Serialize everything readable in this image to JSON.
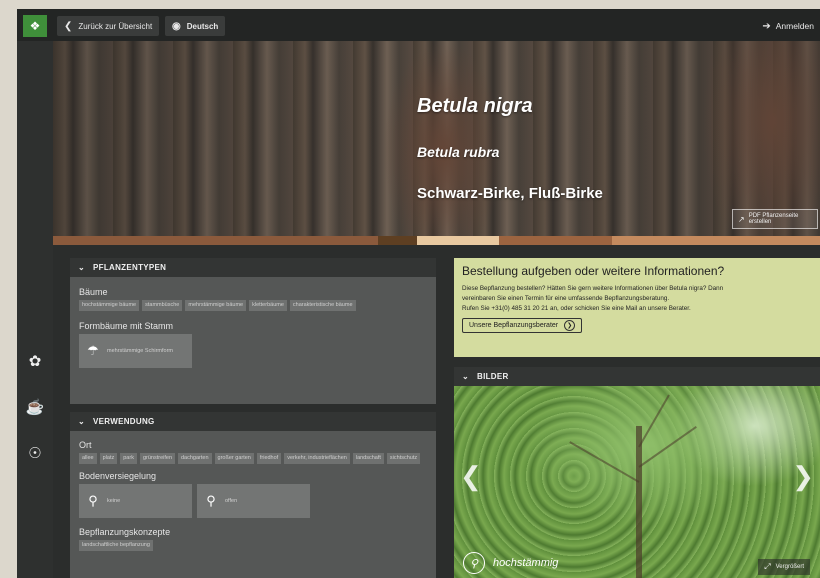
{
  "topbar": {
    "logo_icon": "plant-book-icon",
    "back_label": "Zurück zur Übersicht",
    "language_label": "Deutsch",
    "login_label": "Anmelden"
  },
  "hero": {
    "title": "Betula nigra",
    "synonym": "Betula rubra",
    "common_name": "Schwarz-Birke, Fluß-Birke",
    "pdf_button": "PDF Pflanzenseite erstellen"
  },
  "swatches": [
    "#8b5a3c",
    "#8b5a3c",
    "#5e3f22",
    "#e9c9a0",
    "#9c6440",
    "#c48a5e"
  ],
  "pflanzentypen": {
    "header": "PFLANZENTYPEN",
    "groups": [
      {
        "title": "Bäume",
        "tags": [
          "hochstämmige bäume",
          "stammbüsche",
          "mehrstämmige bäume",
          "kletterbäume",
          "charakteristische bäume"
        ]
      }
    ],
    "formbaeume": {
      "title": "Formbäume mit Stamm",
      "cards": [
        {
          "label": "mehrstämmige Schirmform",
          "icon": "umbrella-tree-icon"
        }
      ]
    }
  },
  "verwendung": {
    "header": "VERWENDUNG",
    "ort": {
      "title": "Ort",
      "tags": [
        "allee",
        "platz",
        "park",
        "grünstreifen",
        "dachgarten",
        "großer garten",
        "friedhof",
        "verkehr, industrieflächen",
        "landschaft",
        "sichtschutz"
      ]
    },
    "boden": {
      "title": "Bodenversiegelung",
      "cards": [
        {
          "label": "keine",
          "icon": "tree-no-seal-icon"
        },
        {
          "label": "offen",
          "icon": "tree-open-seal-icon"
        }
      ]
    },
    "konzepte": {
      "title": "Bepflanzungskonzepte",
      "tags": [
        "landschaftliche bepflanzung"
      ]
    }
  },
  "info": {
    "title": "Bestellung aufgeben oder weitere Informationen?",
    "line1": "Diese Bepflanzung bestellen? Hätten Sie gern weitere Informationen über Betula nigra? Dann",
    "line2": "vereinbaren Sie einen Termin für eine umfassende Bepflanzungsberatung.",
    "line3": "Rufen Sie +31(0) 485 31 20 21 an, oder schicken Sie eine Mail an unsere Berater.",
    "cta": "Unsere Bepflanzungsberater"
  },
  "bilder": {
    "header": "BILDER",
    "caption": "hochstämmig",
    "zoom": "Vergrößert"
  }
}
